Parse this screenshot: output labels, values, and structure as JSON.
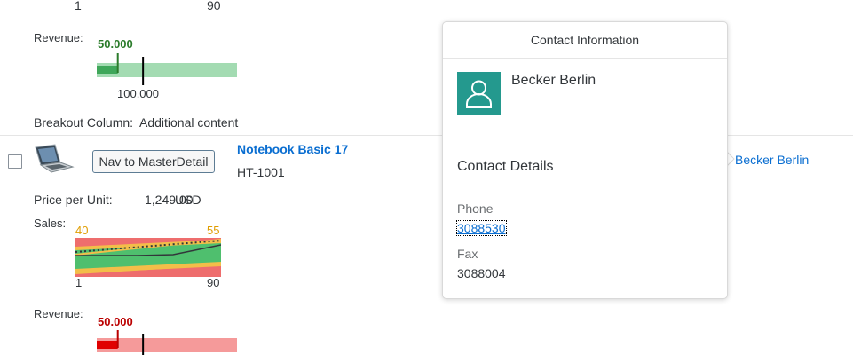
{
  "top_chart": {
    "axis_start": "1",
    "axis_end": "90"
  },
  "revenue_top": {
    "label": "Revenue:",
    "value_label": "50.000",
    "target_label": "100.000",
    "value_fraction": 0.15,
    "target_fraction": 0.33,
    "value_color": "#2b7c2b",
    "bar_color": "#a3dbb2",
    "fill_color": "#3fa75a"
  },
  "breakout": {
    "label": "Breakout Column:",
    "value": "Additional content"
  },
  "row": {
    "nav_button": "Nav to MasterDetail",
    "product_name": "Notebook Basic 17",
    "product_id": "HT-1001",
    "price_label": "Price per Unit:",
    "price_value": "1,249.00",
    "currency": "USD",
    "sales_label": "Sales:",
    "sales_min_label": "40",
    "sales_max_label": "55",
    "sales_axis_start": "1",
    "sales_axis_end": "90",
    "supplier_link": "Becker Berlin"
  },
  "revenue_bottom": {
    "label": "Revenue:",
    "value_label": "50.000",
    "value_fraction": 0.15,
    "target_fraction": 0.33,
    "value_color": "#bb0000",
    "bar_color": "#f59a9a",
    "fill_color": "#e00000"
  },
  "popover": {
    "title": "Contact Information",
    "name": "Becker Berlin",
    "section_title": "Contact Details",
    "phone_label": "Phone",
    "phone_value": "3088530",
    "fax_label": "Fax",
    "fax_value": "3088004",
    "avatar_color": "#24998e",
    "avatar_icon": "person-icon"
  },
  "colors": {
    "link": "#0a6ed1",
    "accent_orange": "#e09d00"
  }
}
